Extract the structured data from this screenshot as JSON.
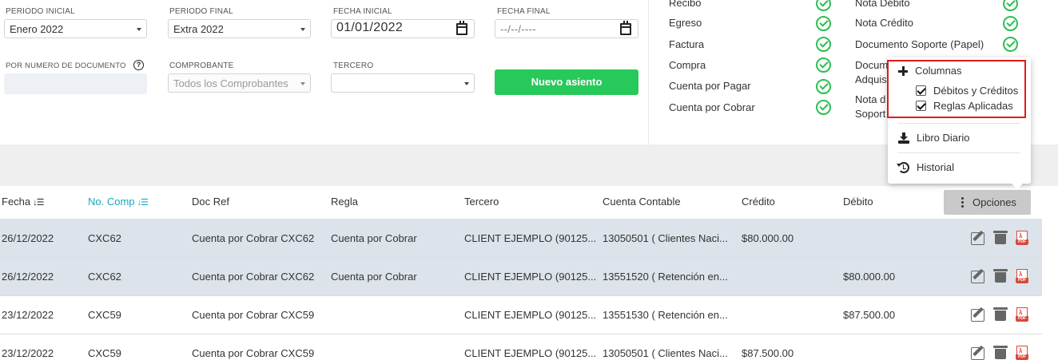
{
  "filters": {
    "periodo_inicial": {
      "label": "PERIODO INICIAL",
      "value": "Enero 2022"
    },
    "periodo_final": {
      "label": "PERIODO FINAL",
      "value": "Extra 2022"
    },
    "fecha_inicial": {
      "label": "FECHA INICIAL",
      "value": "01/01/2022"
    },
    "fecha_final": {
      "label": "FECHA FINAL",
      "value": "--/--/----"
    },
    "numero_documento": {
      "label": "POR NUMERO DE DOCUMENTO",
      "help": "?",
      "value": ""
    },
    "comprobante": {
      "label": "COMPROBANTE",
      "placeholder": "Todos los Comprobantes"
    },
    "tercero": {
      "label": "TERCERO",
      "value": ""
    },
    "nuevo_asiento": "Nuevo asiento"
  },
  "doc_types": {
    "left": [
      "Recibo",
      "Egreso",
      "Factura",
      "Compra",
      "Cuenta por Pagar",
      "Cuenta por Cobrar"
    ],
    "right": [
      "Nota Débito",
      "Nota Crédito",
      "Documento Soporte (Papel)",
      "Docum",
      "Adquis",
      "Nota d",
      "Soport"
    ]
  },
  "table": {
    "headers": {
      "fecha": "Fecha",
      "no_comp": "No. Comp",
      "doc_ref": "Doc Ref",
      "regla": "Regla",
      "tercero": "Tercero",
      "cuenta": "Cuenta Contable",
      "credito": "Crédito",
      "debito": "Débito"
    },
    "options_label": "Opciones",
    "rows": [
      {
        "fecha": "26/12/2022",
        "comp": "CXC62",
        "doc_ref": "Cuenta por Cobrar CXC62",
        "regla": "Cuenta por Cobrar",
        "tercero": "CLIENT EJEMPLO (90125...",
        "cuenta": "13050501 ( Clientes Naci...",
        "credito": "$80.000.00",
        "debito": ""
      },
      {
        "fecha": "26/12/2022",
        "comp": "CXC62",
        "doc_ref": "Cuenta por Cobrar CXC62",
        "regla": "Cuenta por Cobrar",
        "tercero": "CLIENT EJEMPLO (90125...",
        "cuenta": "13551520 ( Retención en...",
        "credito": "",
        "debito": "$80.000.00"
      },
      {
        "fecha": "23/12/2022",
        "comp": "CXC59",
        "doc_ref": "Cuenta por Cobrar CXC59",
        "regla": "",
        "tercero": "CLIENT EJEMPLO (90125...",
        "cuenta": "13551530 ( Retención en...",
        "credito": "",
        "debito": "$87.500.00"
      },
      {
        "fecha": "23/12/2022",
        "comp": "CXC59",
        "doc_ref": "Cuenta por Cobrar CXC59",
        "regla": "",
        "tercero": "CLIENT EJEMPLO (90125...",
        "cuenta": "13050501 ( Clientes Naci...",
        "credito": "$87.500.00",
        "debito": ""
      }
    ]
  },
  "options_menu": {
    "columnas": "Columnas",
    "debitos_creditos": "Débitos y Créditos",
    "reglas_aplicadas": "Reglas Aplicadas",
    "libro_diario": "Libro Diario",
    "historial": "Historial"
  },
  "colors": {
    "accent_green": "#27c95a",
    "teal": "#17a8c4",
    "highlight_red": "#e11b1b",
    "check_green": "#2cbf52"
  },
  "icons": [
    "chevron-down-icon",
    "calendar-icon",
    "help-icon",
    "check-circle-icon",
    "sort-icon",
    "kebab-icon",
    "plus-icon",
    "checkbox-icon",
    "download-icon",
    "history-icon",
    "edit-icon",
    "trash-icon",
    "pdf-icon"
  ]
}
